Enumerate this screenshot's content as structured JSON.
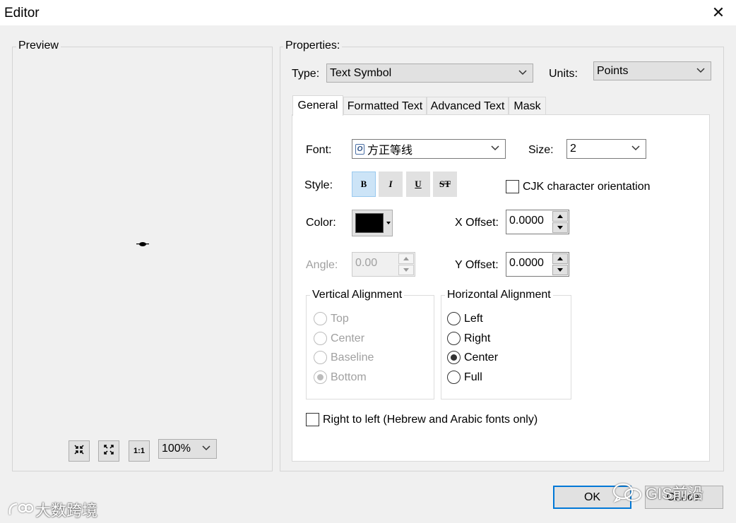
{
  "window": {
    "title": "Editor"
  },
  "preview": {
    "group_label": "Preview",
    "zoom_value": "100%",
    "toolbar": [
      "zoom-in-icon",
      "fit-icon",
      "actual-size-icon"
    ]
  },
  "properties": {
    "group_label": "Properties:",
    "type_label": "Type:",
    "type_value": "Text Symbol",
    "units_label": "Units:",
    "units_value": "Points"
  },
  "tabs": [
    {
      "label": "General",
      "active": true
    },
    {
      "label": "Formatted Text",
      "active": false
    },
    {
      "label": "Advanced Text",
      "active": false
    },
    {
      "label": "Mask",
      "active": false
    }
  ],
  "general": {
    "font_label": "Font:",
    "font_value": "方正等线",
    "size_label": "Size:",
    "size_value": "2",
    "style_label": "Style:",
    "style_buttons": [
      {
        "glyph": "B",
        "pressed": true
      },
      {
        "glyph": "I",
        "pressed": false
      },
      {
        "glyph": "U",
        "pressed": false
      },
      {
        "glyph": "ST",
        "pressed": false
      }
    ],
    "cjk_label": "CJK character orientation",
    "color_label": "Color:",
    "color_value": "#000000",
    "x_offset_label": "X Offset:",
    "x_offset_value": "0.0000",
    "y_offset_label": "Y Offset:",
    "y_offset_value": "0.0000",
    "angle_label": "Angle:",
    "angle_value": "0.00",
    "vertical_alignment": {
      "label": "Vertical Alignment",
      "options": [
        "Top",
        "Center",
        "Baseline",
        "Bottom"
      ],
      "selected": "Bottom",
      "enabled": false
    },
    "horizontal_alignment": {
      "label": "Horizontal Alignment",
      "options": [
        "Left",
        "Right",
        "Center",
        "Full"
      ],
      "selected": "Center",
      "enabled": true
    },
    "rtl_label": "Right to left (Hebrew and Arabic fonts only)"
  },
  "buttons": {
    "ok": "OK",
    "cancel": "Cancel"
  },
  "watermarks": {
    "left": "大数跨境",
    "right": "GIS前沿"
  }
}
